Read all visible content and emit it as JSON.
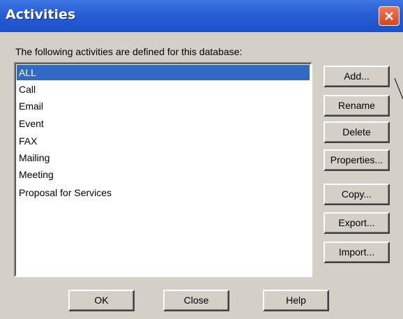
{
  "window": {
    "title": "Activities"
  },
  "caption": "The following activities are defined for this database:",
  "activities": [
    "ALL",
    "Call",
    "Email",
    "Event",
    "FAX",
    "Mailing",
    "Meeting",
    "Proposal for Services"
  ],
  "selected_index": 0,
  "side_buttons": [
    "Add...",
    "Rename",
    "Delete",
    "Properties...",
    "Copy...",
    "Export...",
    "Import..."
  ],
  "bottom_buttons": [
    "OK",
    "Close",
    "Help"
  ],
  "colors": {
    "titlebar": "#2a5fd6",
    "selection": "#316ac5",
    "dialog": "#d4d0c8"
  },
  "icons": {
    "close": "close-icon"
  }
}
